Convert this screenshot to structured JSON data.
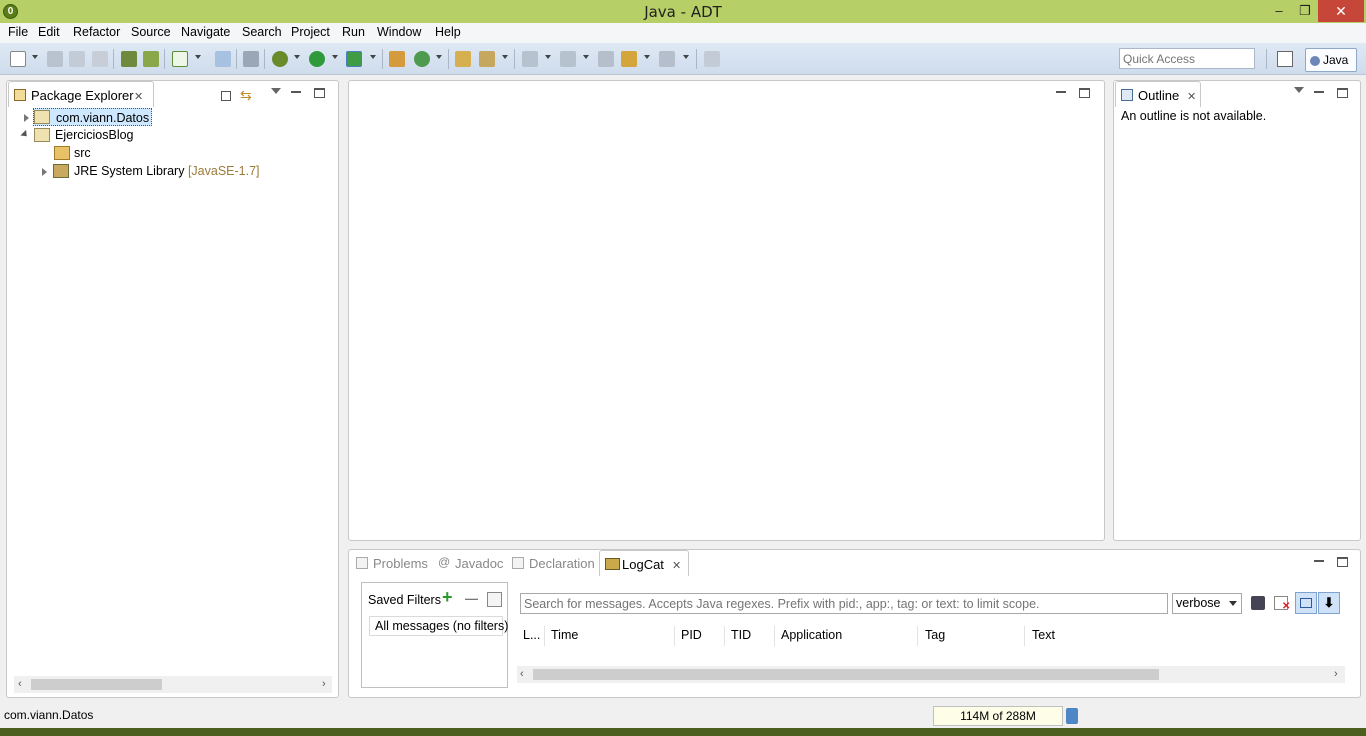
{
  "window": {
    "title": "Java - ADT",
    "logo_letter": "0",
    "minimize": "–",
    "restore": "❐",
    "close": "✕"
  },
  "menu": [
    "File",
    "Edit",
    "Refactor",
    "Source",
    "Navigate",
    "Search",
    "Project",
    "Run",
    "Window",
    "Help"
  ],
  "toolbar": {
    "quick_access_placeholder": "Quick Access",
    "perspective": "Java"
  },
  "package_explorer": {
    "tab_label": "Package Explorer",
    "tree": [
      {
        "label": "com.viann.Datos",
        "selected": true
      },
      {
        "label": "EjerciciosBlog"
      },
      {
        "label": "src"
      },
      {
        "label": "JRE System Library",
        "suffix": "[JavaSE-1.7]"
      }
    ]
  },
  "outline": {
    "tab_label": "Outline",
    "message": "An outline is not available."
  },
  "bottom_tabs": [
    "Problems",
    "Javadoc",
    "Declaration",
    "LogCat"
  ],
  "logcat": {
    "saved_filters_label": "Saved Filters",
    "add_icon": "+",
    "remove_icon": "—",
    "all_messages": "All messages (no filters)",
    "search_placeholder": "Search for messages. Accepts Java regexes. Prefix with pid:, app:, tag: or text: to limit scope.",
    "level": "verbose",
    "columns": [
      "L...",
      "Time",
      "PID",
      "TID",
      "Application",
      "Tag",
      "Text"
    ]
  },
  "status": {
    "selection": "com.viann.Datos",
    "heap": "114M of 288M"
  },
  "colors": {
    "title_bar": "#b6cf66",
    "close_button": "#c7463a",
    "selection": "#cde8ff",
    "jre_suffix": "#9a7b3a"
  }
}
